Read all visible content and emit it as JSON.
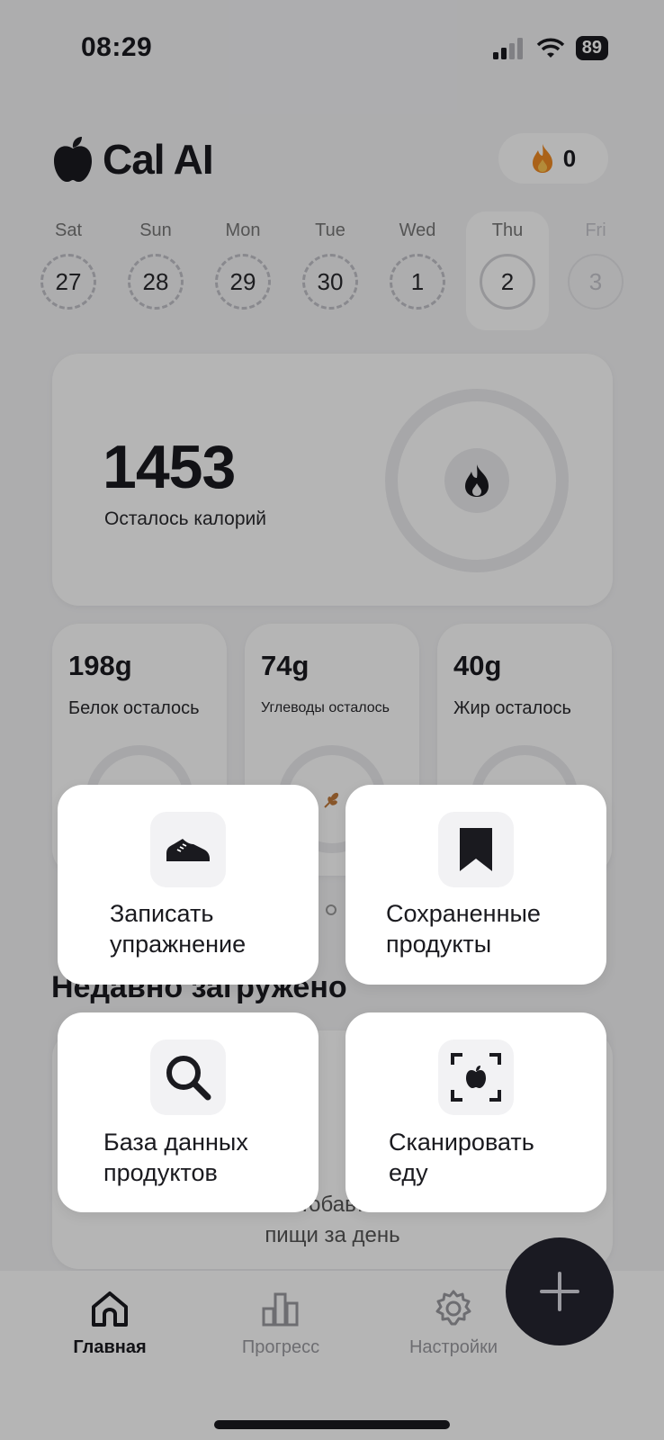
{
  "status": {
    "time": "08:29",
    "battery": "89"
  },
  "header": {
    "app_title": "Cal AI",
    "streak_count": "0"
  },
  "days": [
    {
      "name": "Sat",
      "num": "27"
    },
    {
      "name": "Sun",
      "num": "28"
    },
    {
      "name": "Mon",
      "num": "29"
    },
    {
      "name": "Tue",
      "num": "30"
    },
    {
      "name": "Wed",
      "num": "1"
    },
    {
      "name": "Thu",
      "num": "2"
    },
    {
      "name": "Fri",
      "num": "3"
    }
  ],
  "calories": {
    "value": "1453",
    "label": "Осталось калорий"
  },
  "macros": [
    {
      "value": "198g",
      "label": "Белок осталось"
    },
    {
      "value": "74g",
      "label": "Углеводы осталось"
    },
    {
      "value": "40g",
      "label": "Жир осталось"
    }
  ],
  "recent": {
    "title": "Недавно загружено",
    "empty_line1": "…обав…",
    "empty_line2": "пищи за день"
  },
  "actions": [
    {
      "line1": "Записать",
      "line2": "упражнение",
      "icon": "sneaker-icon"
    },
    {
      "line1": "Сохраненные",
      "line2": "продукты",
      "icon": "bookmark-icon"
    },
    {
      "line1": "База данных",
      "line2": "продуктов",
      "icon": "search-icon"
    },
    {
      "line1": "Сканировать",
      "line2": "еду",
      "icon": "scan-food-icon"
    }
  ],
  "nav": {
    "home": "Главная",
    "progress": "Прогресс",
    "settings": "Настройки"
  }
}
